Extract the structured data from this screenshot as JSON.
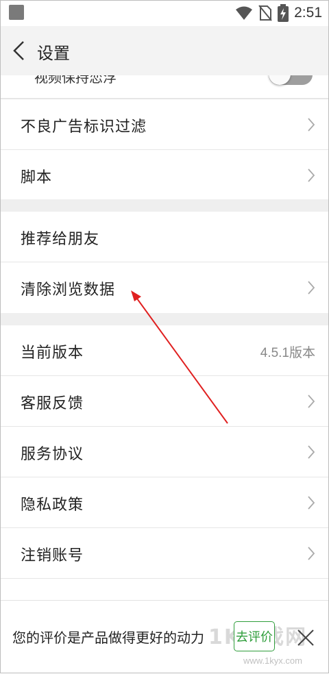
{
  "status_bar": {
    "time": "2:51"
  },
  "header": {
    "title": "设置"
  },
  "partial_row": {
    "label": "视频保持恋浮"
  },
  "section1": [
    {
      "label": "不良广告标识过滤"
    },
    {
      "label": "脚本"
    }
  ],
  "section2": [
    {
      "label": "推荐给朋友"
    },
    {
      "label": "清除浏览数据"
    }
  ],
  "section3": [
    {
      "label": "当前版本",
      "value": "4.5.1版本"
    },
    {
      "label": "客服反馈"
    },
    {
      "label": "服务协议"
    },
    {
      "label": "隐私政策"
    },
    {
      "label": "注销账号"
    }
  ],
  "rating_bar": {
    "text": "您的评价是产品做得更好的动力",
    "button": "去评价"
  },
  "watermark": {
    "brand": "1K游戏网",
    "url": "www.1kyx.com"
  },
  "colors": {
    "accent_green": "#2e9d3a",
    "annotation_arrow": "#e02020"
  },
  "icons": [
    "back-chevron-icon",
    "wifi-icon",
    "no-sim-icon",
    "battery-charging-icon",
    "chevron-right-icon",
    "close-icon"
  ]
}
